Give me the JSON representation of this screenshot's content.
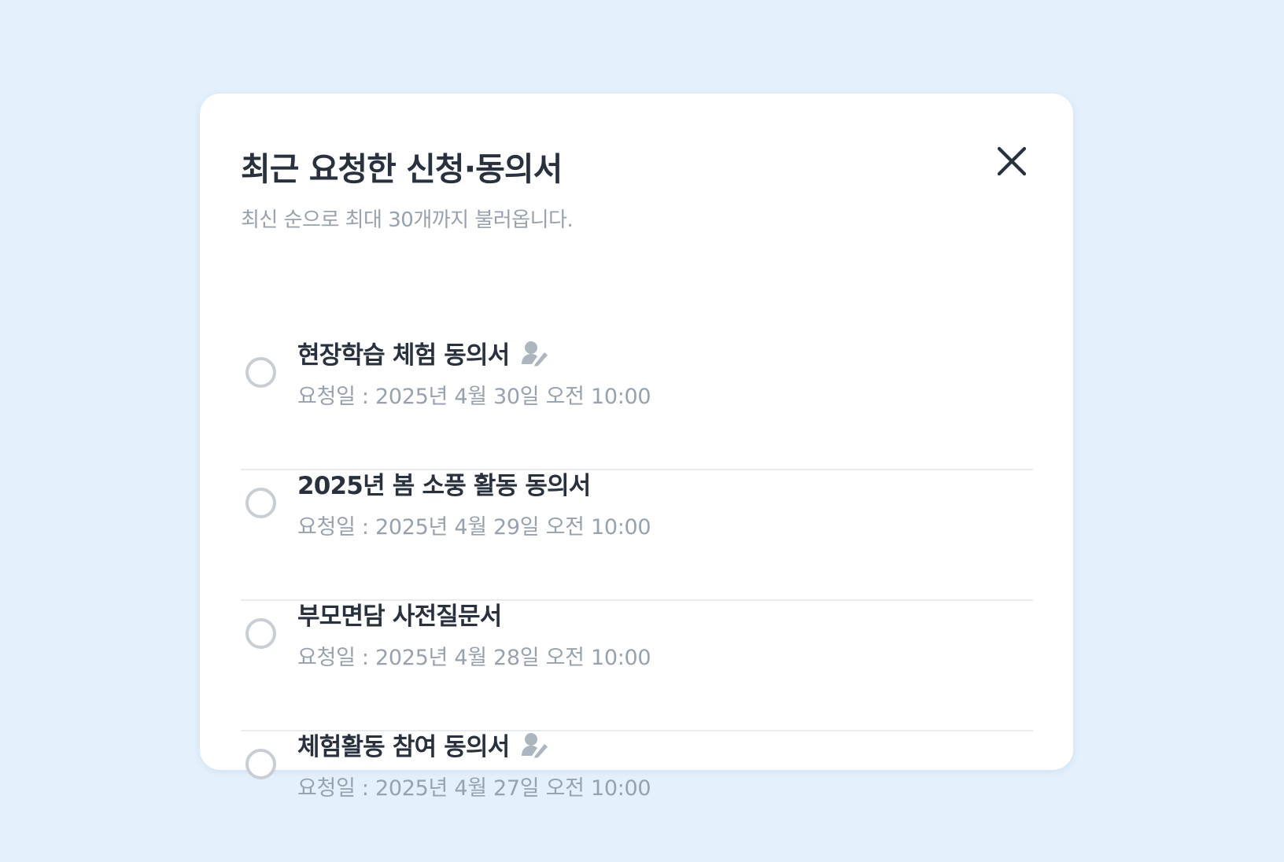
{
  "dialog": {
    "title": "최근 요청한 신청·동의서",
    "subtitle": "최신 순으로 최대 30개까지 불러옵니다.",
    "close_icon": "close-icon"
  },
  "colors": {
    "background": "#E4F1FD",
    "card": "#FFFFFF",
    "title_text": "#28313D",
    "muted_text": "#98A2AE",
    "radio_border": "#C9CED5",
    "divider": "#E9ECEF",
    "icon": "#ADB5BF"
  },
  "items": [
    {
      "title": "현장학습 체험 동의서",
      "date": "요청일 : 2025년 4월 30일 오전 10:00",
      "has_sign_icon": true,
      "selected": false
    },
    {
      "title": "2025년 봄 소풍 활동 동의서",
      "date": "요청일 : 2025년 4월 29일 오전 10:00",
      "has_sign_icon": false,
      "selected": false
    },
    {
      "title": "부모면담 사전질문서",
      "date": "요청일 : 2025년 4월 28일 오전 10:00",
      "has_sign_icon": false,
      "selected": false
    },
    {
      "title": "체험활동 참여 동의서",
      "date": "요청일 : 2025년 4월 27일 오전 10:00",
      "has_sign_icon": true,
      "selected": false
    }
  ]
}
